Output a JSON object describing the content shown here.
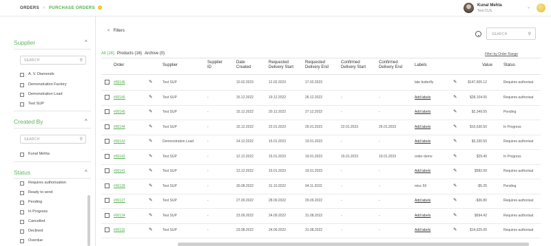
{
  "header": {
    "breadcrumb": {
      "root": "ORDERS",
      "separator": ">",
      "current": "PURCHASE ORDERS",
      "badge": "i"
    },
    "user": {
      "name": "Kunal Mehta",
      "subtitle": "Test CUS",
      "chevron": "⌄"
    }
  },
  "sidebar": {
    "supplier": {
      "title": "Supplier",
      "chevron": "^",
      "search_placeholder": "SEARCH",
      "options": [
        "A. V. Diamonds",
        "Demonstration Factory",
        "Demonstration Load",
        "Test SUP"
      ]
    },
    "created_by": {
      "title": "Created By",
      "chevron": "^",
      "search_placeholder": "SEARCH",
      "options": [
        "Kunal Mehta"
      ]
    },
    "status": {
      "title": "Status",
      "chevron": "^",
      "options": [
        "Requires authorisation",
        "Ready to send",
        "Pending",
        "In Progress",
        "Cancelled",
        "Declined",
        "Overdue"
      ]
    }
  },
  "main": {
    "filters_label": "Filters",
    "filters_arrow": "<",
    "search_placeholder": "SEARCH",
    "tabs": [
      {
        "label": "All (16)"
      },
      {
        "label": "Products (16)"
      },
      {
        "label": "Archive (0)"
      }
    ],
    "toggle_label": "Filter by Order Range",
    "columns": {
      "order": "Order",
      "supplier": "Supplier",
      "supplier_id_1": "Supplier",
      "supplier_id_2": "ID",
      "date_1": "Date",
      "date_2": "Created",
      "rds_1": "Requested",
      "rds_2": "Delivery Start",
      "rde_1": "Requested",
      "rde_2": "Delivery End",
      "cds_1": "Confirmed",
      "cds_2": "Delivery Start",
      "cde_1": "Confirmed",
      "cde_2": "Delivery End",
      "labels": "Labels",
      "value": "Value",
      "status": "Status"
    },
    "rows": [
      {
        "order": "#00146",
        "supplier": "Test SUP",
        "supplier_id": "",
        "created": "10.02.2023",
        "rds": "12.02.2023",
        "rde": "17.02.2023",
        "cds": "",
        "cde": "",
        "labels": "late butterfly",
        "labels_link": false,
        "value": "$147,605.12",
        "status": "Requires authorisat"
      },
      {
        "order": "#00145",
        "supplier": "Test SUP",
        "supplier_id": "-",
        "created": "15.12.2022",
        "rds": "19.12.2022",
        "rde": "26.12.2022",
        "cds": "-",
        "cde": "-",
        "labels": "Add labels",
        "labels_link": true,
        "value": "$28,104.05",
        "status": "Requires authorisat"
      },
      {
        "order": "#00145",
        "supplier": "Test SUP",
        "supplier_id": "-",
        "created": "15.12.2022",
        "rds": "20.12.2022",
        "rde": "27.12.2022",
        "cds": "-",
        "cde": "-",
        "labels": "Add labels",
        "labels_link": true,
        "value": "$2,349.55",
        "status": "Pending"
      },
      {
        "order": "#00144",
        "supplier": "Test SUP",
        "supplier_id": "-",
        "created": "15.12.2022",
        "rds": "22.01.2023",
        "rde": "26.01.2023",
        "cds": "22.01.2023",
        "cde": "26.01.2023",
        "labels": "Add labels",
        "labels_link": true,
        "value": "$10,636.50",
        "status": "In Progress"
      },
      {
        "order": "#00143",
        "supplier": "Demonstration Load",
        "supplier_id": "-",
        "created": "14.12.2022",
        "rds": "15.01.2023",
        "rde": "19.01.2023",
        "cds": "-",
        "cde": "-",
        "labels": "Add labels",
        "labels_link": true,
        "value": "$3,330.50",
        "status": "Requires authorisat"
      },
      {
        "order": "#00142",
        "supplier": "Test SUP",
        "supplier_id": "-",
        "created": "12.12.2022",
        "rds": "15.01.2023",
        "rde": "19.01.2023",
        "cds": "15.01.2023",
        "cde": "19.01.2023",
        "labels": "order demo",
        "labels_link": false,
        "value": "$29.40",
        "status": "In Progress"
      },
      {
        "order": "#00141",
        "supplier": "Test SUP",
        "supplier_id": "-",
        "created": "12.12.2022",
        "rds": "15.01.2023",
        "rde": "19.01.2023",
        "cds": "-",
        "cde": "-",
        "labels": "Add labels",
        "labels_link": true,
        "value": "$582.00",
        "status": "Requires authorisat"
      },
      {
        "order": "#00139",
        "supplier": "Test SUP",
        "supplier_id": "-",
        "created": "30.08.2022",
        "rds": "31.10.2022",
        "rde": "04.11.2022",
        "cds": "-",
        "cde": "-",
        "labels": "misc 56",
        "labels_link": false,
        "value": "-$5.25",
        "status": "Pending"
      },
      {
        "order": "#00127",
        "supplier": "Test SUP",
        "supplier_id": "-",
        "created": "27.09.2022",
        "rds": "28.09.2022",
        "rde": "29.09.2022",
        "cds": "-",
        "cde": "-",
        "labels": "Add labels",
        "labels_link": true,
        "value": "-$36.80",
        "status": "Requires authorisat"
      },
      {
        "order": "#00124",
        "supplier": "Test SUP",
        "supplier_id": "-",
        "created": "23.09.2022",
        "rds": "24.09.2022",
        "rde": "31.08.2022",
        "cds": "-",
        "cde": "-",
        "labels": "Add labels",
        "labels_link": true,
        "value": "$694.42",
        "status": "Requires authorisat"
      },
      {
        "order": "#00116",
        "supplier": "Test SUP",
        "supplier_id": "-",
        "created": "23.08.2022",
        "rds": "24.09.2022",
        "rde": "31.08.2022",
        "cds": "-",
        "cde": "-",
        "labels": "Add labels",
        "labels_link": true,
        "value": "$14,625.00",
        "status": "Requires authorisat"
      }
    ]
  },
  "icons": {
    "search": "search-icon",
    "export": "export-icon",
    "edit": "pencil-icon",
    "close_coin": "notification-icon"
  }
}
